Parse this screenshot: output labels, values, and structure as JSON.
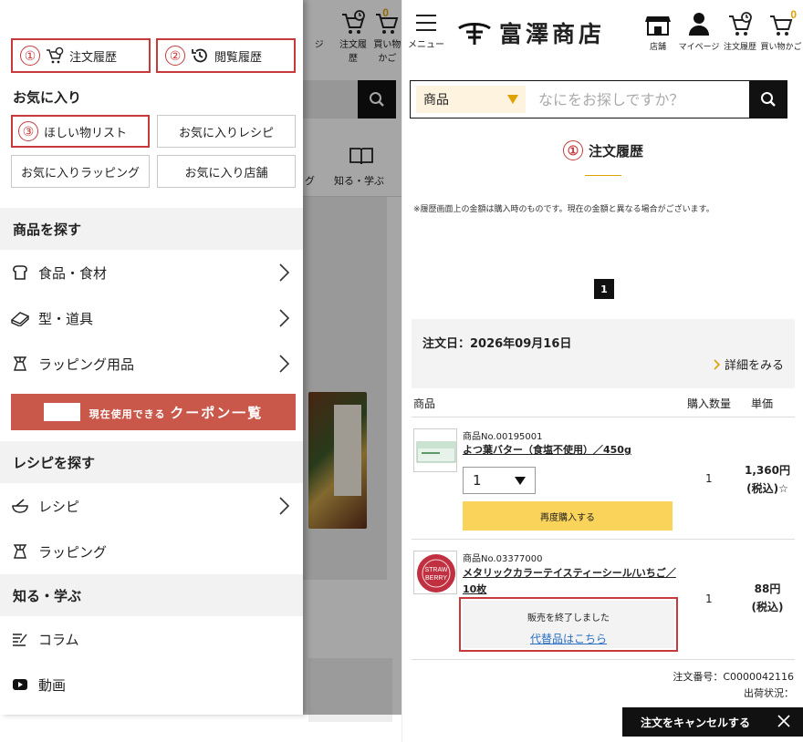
{
  "left": {
    "bg_header": {
      "mypage_partial": "ジ",
      "order_history": "注文履歴",
      "cart": "買い物かご",
      "cart_count": "0"
    },
    "bg_nav": {
      "partial": "グ",
      "learn": "知る・学ぶ"
    },
    "drawer": {
      "history_buttons": [
        {
          "num": "①",
          "label": "注文履歴"
        },
        {
          "num": "②",
          "label": "閲覧履歴"
        }
      ],
      "favorites_title": "お気に入り",
      "favorites": [
        {
          "num": "③",
          "label": "ほしい物リスト"
        },
        {
          "label": "お気に入りレシピ"
        },
        {
          "label": "お気に入りラッピング"
        },
        {
          "label": "お気に入り店舗"
        }
      ],
      "section_products": "商品を探す",
      "product_items": [
        {
          "label": "食品・食材",
          "icon": "bread-icon"
        },
        {
          "label": "型・道具",
          "icon": "tool-icon"
        },
        {
          "label": "ラッピング用品",
          "icon": "wrapping-icon"
        }
      ],
      "coupon": {
        "small": "現在使用できる",
        "large": "クーポン一覧"
      },
      "section_recipes": "レシピを探す",
      "recipe_items": [
        {
          "label": "レシピ",
          "icon": "bowl-icon"
        },
        {
          "label": "ラッピング",
          "icon": "wrapping-icon"
        }
      ],
      "section_learn": "知る・学ぶ",
      "learn_items": [
        {
          "label": "コラム",
          "icon": "column-icon"
        },
        {
          "label": "動画",
          "icon": "video-icon"
        }
      ]
    }
  },
  "right": {
    "header": {
      "menu_label": "メニュー",
      "logo_text": "富澤商店",
      "icons": [
        {
          "label": "店舗",
          "icon": "store-icon"
        },
        {
          "label": "マイページ",
          "icon": "user-icon"
        },
        {
          "label": "注文履歴",
          "icon": "order-history-icon"
        },
        {
          "label": "買い物かご",
          "icon": "cart-icon"
        }
      ],
      "cart_count": "0"
    },
    "search": {
      "category": "商品",
      "placeholder": "なにをお探しですか？"
    },
    "heading": {
      "num": "①",
      "title": "注文履歴"
    },
    "notice": "※履歴画面上の金額は購入時のものです。現在の金額と異なる場合がございます。",
    "pager": {
      "current": "1"
    },
    "order": {
      "date_label": "注文日：2026年09月16日",
      "detail_link": "詳細をみる"
    },
    "table_headers": {
      "product": "商品",
      "quantity": "購入数量",
      "unit_price": "単価"
    },
    "items": [
      {
        "number": "商品No.00195001",
        "name": "よつ葉バター（食塩不使用）／450g",
        "qty_select": "1",
        "quantity": "1",
        "price": "1,360円",
        "tax": "(税込)☆",
        "rebuy_label": "再度購入する"
      },
      {
        "number": "商品No.03377000",
        "name_line1": "メタリックカラーテイスティーシール/いちご／",
        "name_line2": "10枚",
        "seal_text1": "STRAW",
        "seal_text2": "BERRY",
        "quantity": "1",
        "price": "88円",
        "tax": "(税込)",
        "ended_text": "販売を終了しました",
        "alt_link": "代替品はこちら"
      }
    ],
    "order_meta": {
      "order_number": "注文番号：C0000042116",
      "shipping_status": "出荷状況："
    },
    "cancel_button": "注文をキャンセルする",
    "colors": {
      "highlight_red": "#c8393b",
      "accent_yellow": "#e0a000",
      "rebuy_yellow": "#fad35a",
      "coupon_red": "#c9584b",
      "link_blue": "#2a6fc5"
    }
  }
}
